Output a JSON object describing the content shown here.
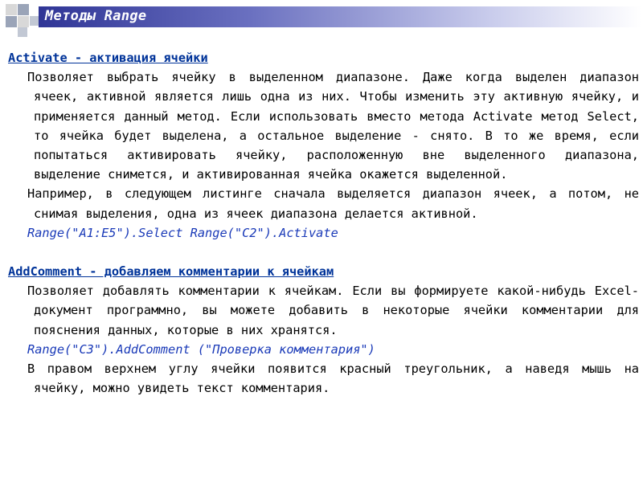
{
  "slide": {
    "title": "Методы Range"
  },
  "sections": [
    {
      "heading": "Activate - активация ячейки",
      "paragraph1": "Позволяет выбрать ячейку в выделенном диапазоне. Даже когда выделен диапазон ячеек, активной является лишь одна из них. Чтобы изменить эту активную ячейку, и применяется данный метод. Если использовать вместо метода Activate метод Select, то ячейка будет выделена, а остальное выделение - снято. В то же время, если попытаться активировать ячейку, расположенную вне выделенного диапазона, выделение снимется, и активированная ячейка окажется выделенной.",
      "paragraph2": "Например, в следующем листинге сначала выделяется диапазон ячеек, а потом, не снимая выделения, одна из ячеек диапазона делается активной.",
      "code": "Range(\"A1:E5\").Select Range(\"C2\").Activate"
    },
    {
      "heading": "AddComment - добавляем комментарии к ячейкам",
      "paragraph1": "Позволяет добавлять комментарии к ячейкам. Если вы формируете какой-нибудь Excel-документ программно, вы можете добавить в некоторые ячейки комментарии для пояснения данных, которые в них хранятся.",
      "code": "Range(\"C3\").AddComment (\"Проверка комментария\")",
      "paragraph2": "В правом верхнем углу ячейки появится красный треугольник, а наведя мышь на ячейку, можно увидеть текст комментария."
    }
  ],
  "colors": {
    "heading": "#003399",
    "code": "#1a3ab8",
    "title_bar_start": "#2f3596"
  }
}
